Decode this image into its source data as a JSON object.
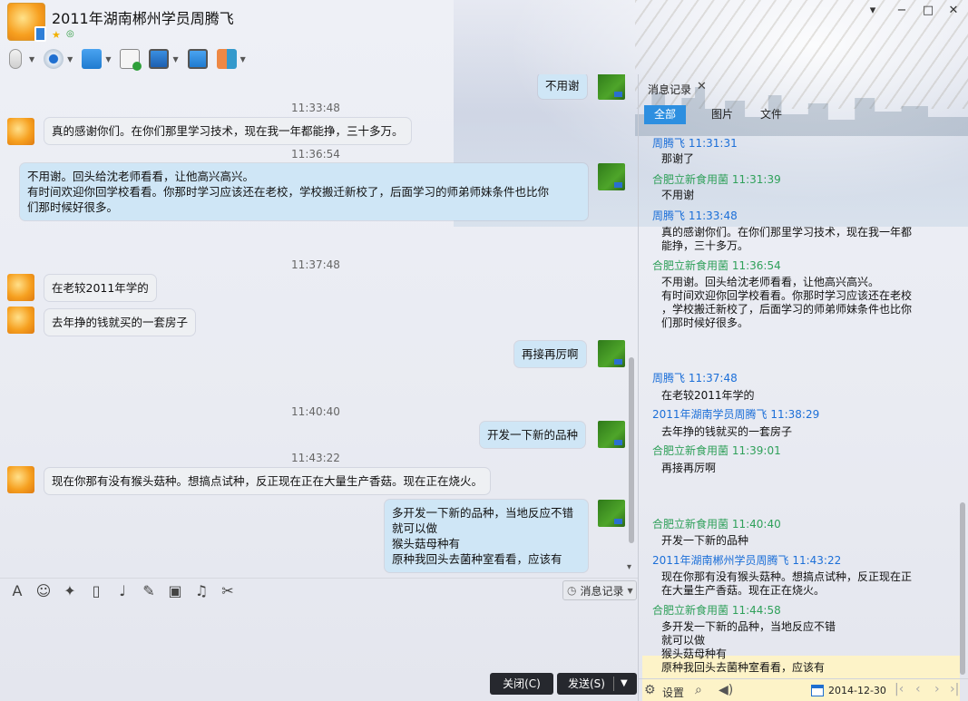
{
  "window": {
    "title": "2011年湖南郴州学员周腾飞",
    "controls": [
      "▾",
      "−",
      "□",
      "✕"
    ]
  },
  "toolbar": {
    "items": [
      "voice-call",
      "video-call",
      "file-transfer",
      "add-contact",
      "remote-assist",
      "screen-share",
      "apps"
    ]
  },
  "chat": {
    "messages": [
      {
        "side": "out",
        "lines": [
          "不用谢"
        ]
      },
      {
        "time": "11:33:48"
      },
      {
        "side": "in",
        "lines": [
          "真的感谢你们。在你们那里学习技术，现在我一年都能挣，三十多万。"
        ]
      },
      {
        "time": "11:36:54"
      },
      {
        "side": "out",
        "lines": [
          "不用谢。回头给沈老师看看，让他高兴高兴。",
          "有时间欢迎你回学校看看。你那时学习应该还在老校，学校搬迁新校了，后面学习的师弟师妹条件也比你",
          "们那时候好很多。"
        ]
      },
      {
        "time": "11:37:48"
      },
      {
        "side": "in",
        "lines": [
          "在老较2011年学的"
        ]
      },
      {
        "side": "in",
        "lines": [
          "去年挣的钱就买的一套房子"
        ]
      },
      {
        "side": "out",
        "lines": [
          "再接再厉啊"
        ]
      },
      {
        "time": "11:40:40"
      },
      {
        "side": "out",
        "lines": [
          "开发一下新的品种"
        ]
      },
      {
        "time": "11:43:22"
      },
      {
        "side": "in",
        "lines": [
          "现在你那有没有猴头菇种。想搞点试种，反正现在正在大量生产香菇。现在正在烧火。"
        ]
      },
      {
        "side": "out",
        "lines": [
          "多开发一下新的品种，当地反应不错",
          "就可以做",
          "猴头菇母种有",
          "原种我回头去菌种室看看，应该有"
        ]
      }
    ]
  },
  "input_toolbar": {
    "icons": [
      "font-icon",
      "emoji-icon",
      "magic-icon",
      "shake-icon",
      "voice-message-icon",
      "graffiti-icon",
      "image-icon",
      "music-icon",
      "scissors-icon"
    ],
    "history_button": "消息记录"
  },
  "buttons": {
    "close": "关闭(C)",
    "send": "发送(S)"
  },
  "right_panel": {
    "title": "消息记录",
    "filters": [
      "全部",
      "图片",
      "文件"
    ],
    "log": [
      {
        "sender": "周腾飞 11:31:31",
        "color": "blue",
        "lines": [
          "那谢了"
        ]
      },
      {
        "sender": "合肥立新食用菌 11:31:39",
        "color": "green",
        "lines": [
          "不用谢"
        ]
      },
      {
        "sender": "周腾飞 11:33:48",
        "color": "blue",
        "lines": [
          "真的感谢你们。在你们那里学习技术，现在我一年都",
          "能挣，三十多万。"
        ]
      },
      {
        "sender": "合肥立新食用菌 11:36:54",
        "color": "green",
        "lines": [
          "不用谢。回头给沈老师看看，让他高兴高兴。",
          "有时间欢迎你回学校看看。你那时学习应该还在老校",
          "，学校搬迁新校了，后面学习的师弟师妹条件也比你",
          "们那时候好很多。"
        ]
      },
      {
        "sender": "周腾飞 11:37:48",
        "color": "blue",
        "lines": [
          "在老较2011年学的"
        ]
      },
      {
        "sender": "2011年湖南学员周腾飞 11:38:29",
        "color": "blue",
        "lines": [
          "去年挣的钱就买的一套房子"
        ]
      },
      {
        "sender": "合肥立新食用菌 11:39:01",
        "color": "green",
        "lines": [
          "再接再厉啊"
        ]
      },
      {
        "sender": "合肥立新食用菌 11:40:40",
        "color": "green",
        "lines": [
          "开发一下新的品种"
        ]
      },
      {
        "sender": "2011年湖南郴州学员周腾飞 11:43:22",
        "color": "blue",
        "lines": [
          "现在你那有没有猴头菇种。想搞点试种，反正现在正",
          "在大量生产香菇。现在正在烧火。"
        ]
      },
      {
        "sender": "合肥立新食用菌 11:44:58",
        "color": "green",
        "lines": [
          "多开发一下新的品种，当地反应不错",
          "就可以做",
          "猴头菇母种有",
          "原种我回头去菌种室看看，应该有"
        ]
      }
    ],
    "footer": {
      "settings": "设置",
      "date": "2014-12-30"
    }
  },
  "colors": {
    "accent": "#2d8fe0",
    "sender_blue": "#1c6fd8",
    "sender_green": "#2fa05a",
    "bubble_out": "#cfe6f6",
    "highlight": "#fdf3c8"
  }
}
